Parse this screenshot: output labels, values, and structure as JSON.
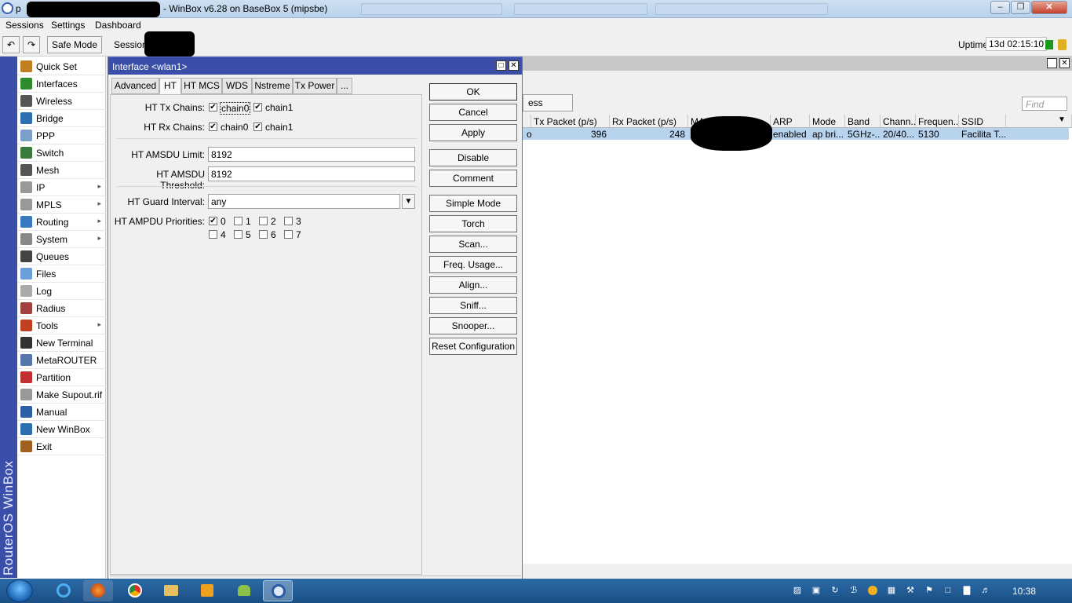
{
  "window": {
    "title": "- WinBox v6.28 on BaseBox 5 (mipsbe)",
    "title_prefix": "p"
  },
  "menu": [
    "Sessions",
    "Settings",
    "Dashboard"
  ],
  "toolbar": {
    "undo_icon": "undo-icon",
    "redo_icon": "redo-icon",
    "safe_mode": "Safe Mode",
    "session_label": "Session",
    "uptime_label": "Uptime:",
    "uptime_value": "13d 02:15:10"
  },
  "sidebar": {
    "brand": "RouterOS WinBox",
    "items": [
      {
        "label": "Quick Set",
        "icon": "wand-icon",
        "color": "#c08020",
        "arrow": false
      },
      {
        "label": "Interfaces",
        "icon": "interfaces-icon",
        "color": "#2e8b2e",
        "arrow": false
      },
      {
        "label": "Wireless",
        "icon": "antenna-icon",
        "color": "#555555",
        "arrow": false
      },
      {
        "label": "Bridge",
        "icon": "bridge-icon",
        "color": "#2d6fb3",
        "arrow": false
      },
      {
        "label": "PPP",
        "icon": "ppp-icon",
        "color": "#7aa0c8",
        "arrow": false
      },
      {
        "label": "Switch",
        "icon": "switch-icon",
        "color": "#3a7a3a",
        "arrow": false
      },
      {
        "label": "Mesh",
        "icon": "mesh-icon",
        "color": "#555555",
        "arrow": false
      },
      {
        "label": "IP",
        "icon": "ip-icon",
        "color": "#999999",
        "arrow": true
      },
      {
        "label": "MPLS",
        "icon": "mpls-icon",
        "color": "#999999",
        "arrow": true
      },
      {
        "label": "Routing",
        "icon": "routing-icon",
        "color": "#3a78c0",
        "arrow": true
      },
      {
        "label": "System",
        "icon": "gear-icon",
        "color": "#888888",
        "arrow": true
      },
      {
        "label": "Queues",
        "icon": "queues-icon",
        "color": "#444444",
        "arrow": false
      },
      {
        "label": "Files",
        "icon": "folder-icon",
        "color": "#6a9fd8",
        "arrow": false
      },
      {
        "label": "Log",
        "icon": "log-icon",
        "color": "#aaaaaa",
        "arrow": false
      },
      {
        "label": "Radius",
        "icon": "radius-icon",
        "color": "#a04040",
        "arrow": false
      },
      {
        "label": "Tools",
        "icon": "tools-icon",
        "color": "#c04020",
        "arrow": true
      },
      {
        "label": "New Terminal",
        "icon": "terminal-icon",
        "color": "#333333",
        "arrow": false
      },
      {
        "label": "MetaROUTER",
        "icon": "metarouter-icon",
        "color": "#5577aa",
        "arrow": false
      },
      {
        "label": "Partition",
        "icon": "partition-icon",
        "color": "#c03030",
        "arrow": false
      },
      {
        "label": "Make Supout.rif",
        "icon": "document-icon",
        "color": "#999999",
        "arrow": false
      },
      {
        "label": "Manual",
        "icon": "help-icon",
        "color": "#2d5fa8",
        "arrow": false
      },
      {
        "label": "New WinBox",
        "icon": "winbox-icon",
        "color": "#2d6fb3",
        "arrow": false
      },
      {
        "label": "Exit",
        "icon": "exit-icon",
        "color": "#a06020",
        "arrow": false
      }
    ]
  },
  "background_window": {
    "snooper_button": "ess Snooper",
    "find_placeholder": "Find",
    "columns": [
      "Tx Packet (p/s)",
      "Rx Packet (p/s)",
      "MAC",
      "ARP",
      "Mode",
      "Band",
      "Chann...",
      "Frequen...",
      "SSID"
    ],
    "row": {
      "prefix": "os",
      "tx_packet": "396",
      "rx_packet": "248",
      "arp": "enabled",
      "mode": "ap bri...",
      "band": "5GHz-...",
      "channel": "20/40...",
      "frequency": "5130",
      "ssid": "Facilita T..."
    }
  },
  "dialog": {
    "title": "Interface <wlan1>",
    "tabs": [
      "Advanced",
      "HT",
      "HT MCS",
      "WDS",
      "Nstreme",
      "Tx Power",
      "..."
    ],
    "active_tab": "HT",
    "ht_tx_chains_label": "HT Tx Chains:",
    "ht_rx_chains_label": "HT Rx Chains:",
    "chain0": "chain0",
    "chain1": "chain1",
    "ht_tx_chain0": true,
    "ht_tx_chain1": true,
    "ht_rx_chain0": true,
    "ht_rx_chain1": true,
    "amsdu_limit_label": "HT AMSDU Limit:",
    "amsdu_limit_value": "8192",
    "amsdu_threshold_label": "HT AMSDU Threshold:",
    "amsdu_threshold_value": "8192",
    "guard_interval_label": "HT Guard Interval:",
    "guard_interval_value": "any",
    "ampdu_label": "HT AMPDU Priorities:",
    "ampdu": [
      {
        "label": "0",
        "checked": true
      },
      {
        "label": "1",
        "checked": false
      },
      {
        "label": "2",
        "checked": false
      },
      {
        "label": "3",
        "checked": false
      },
      {
        "label": "4",
        "checked": false
      },
      {
        "label": "5",
        "checked": false
      },
      {
        "label": "6",
        "checked": false
      },
      {
        "label": "7",
        "checked": false
      }
    ],
    "buttons": [
      "OK",
      "Cancel",
      "Apply",
      "Disable",
      "Comment",
      "Simple Mode",
      "Torch",
      "Scan...",
      "Freq. Usage...",
      "Align...",
      "Sniff...",
      "Snooper...",
      "Reset Configuration"
    ]
  },
  "taskbar": {
    "clock": "10:38",
    "apps": [
      "ie-icon",
      "firefox-icon",
      "chrome-icon",
      "explorer-icon",
      "media-player-icon",
      "android-icon",
      "winbox-icon"
    ]
  }
}
